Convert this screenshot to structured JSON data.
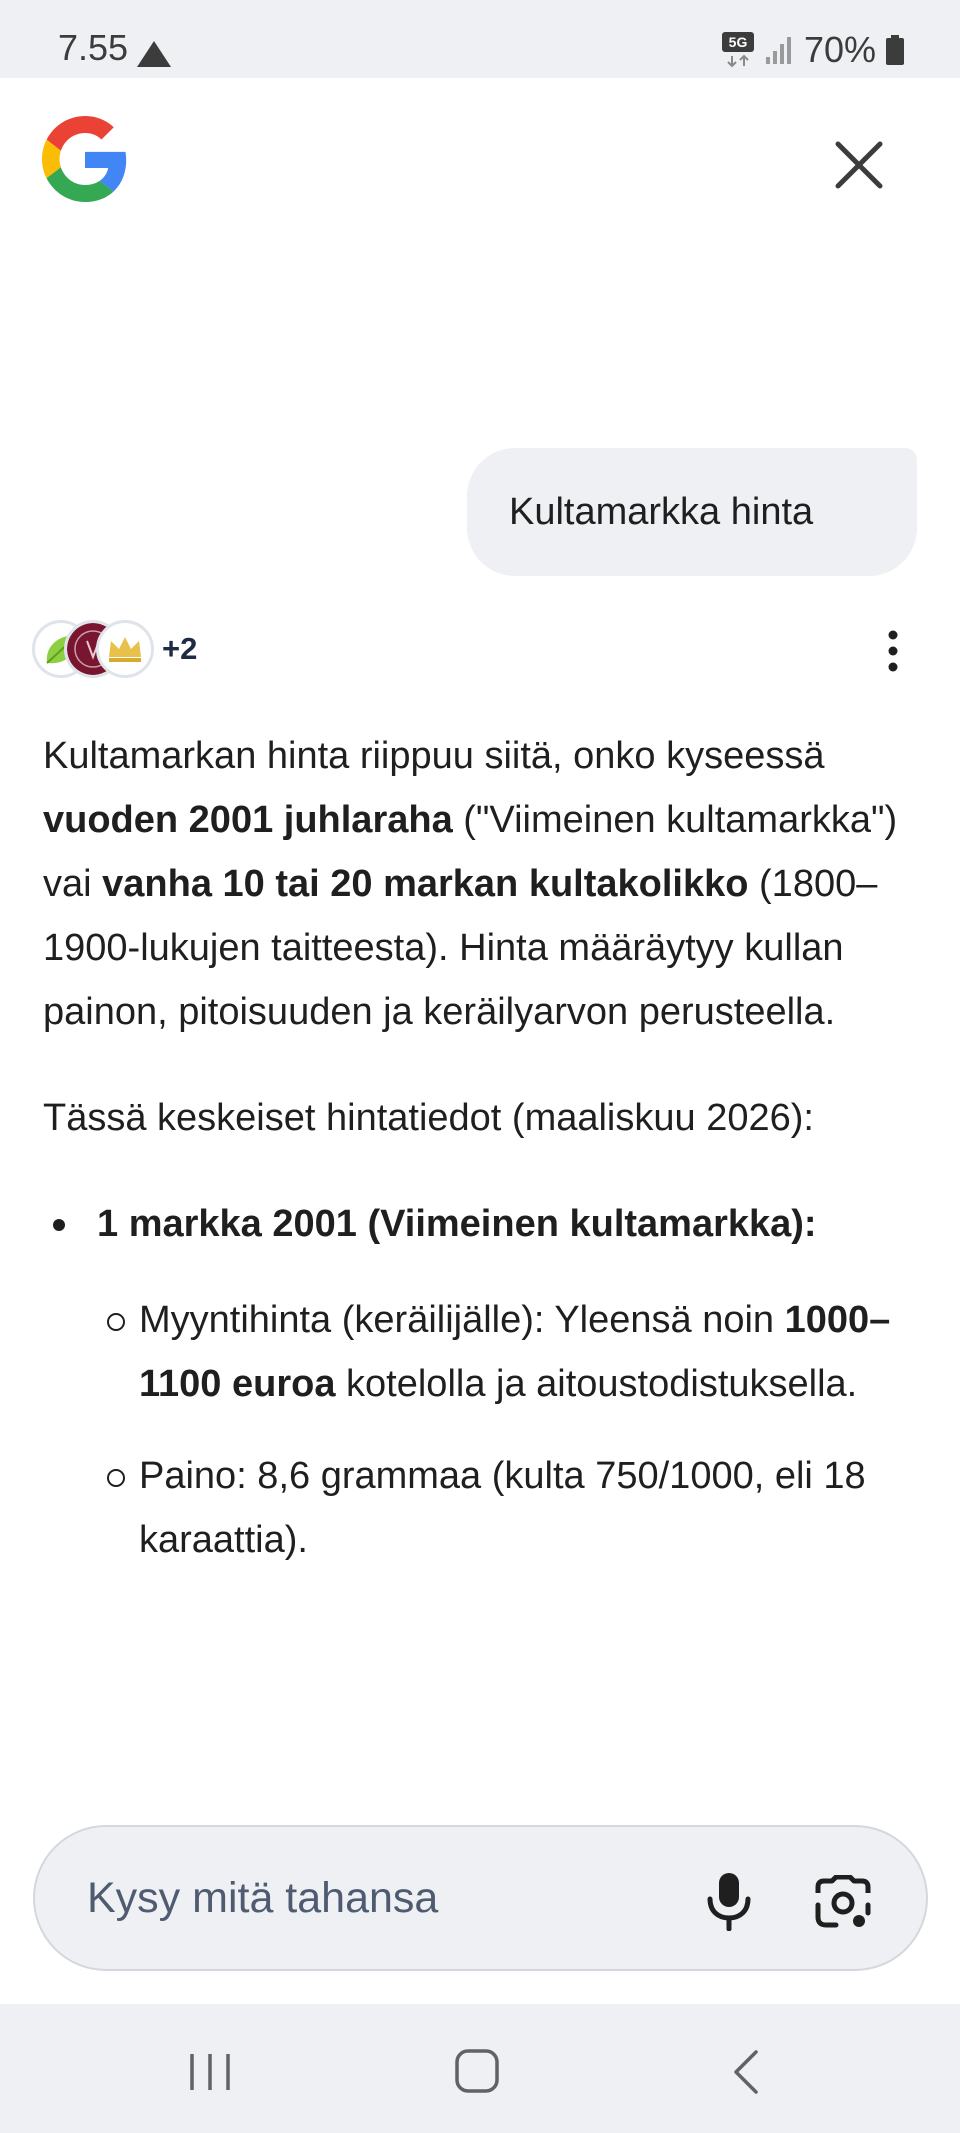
{
  "status_bar": {
    "time": "7.55",
    "network": "5G",
    "battery": "70%"
  },
  "header": {
    "logo": "google-logo",
    "close_icon": "close-icon"
  },
  "query": {
    "text": "Kultamarkka hinta"
  },
  "sources": {
    "more_count": "+2",
    "icons": [
      "birch-leaf-logo",
      "coin-seal-logo",
      "crown-logo"
    ]
  },
  "answer": {
    "p1": {
      "t1": "Kultamarkan hinta riippuu siitä, onko kyseessä ",
      "b1": "vuoden 2001 juhlaraha",
      "t2": " (\"Viimeinen kultamarkka\") vai ",
      "b2": "vanha 10 tai 20 markan kultakolikko",
      "t3": " (1800–1900-lukujen taitteesta). Hinta määräytyy kullan painon, pitoisuuden ja keräilyarvon perusteella."
    },
    "p2": "Tässä keskeiset hintatiedot (maaliskuu 2026):",
    "bullet1": "1 markka 2001 (Viimeinen kultamarkka):",
    "sub1": {
      "t1": "Myyntihinta (keräilijälle): Yleensä noin ",
      "b1": "1000–1100 euroa",
      "t2": " kotelolla ja aitoustodistuksella."
    },
    "sub2": "Paino: 8,6 grammaa (kulta 750/1000, eli 18 karaattia)."
  },
  "input": {
    "placeholder": "Kysy mitä tahansa"
  },
  "colors": {
    "surface": "#eef0f3",
    "text": "#1f1f1f",
    "placeholder": "#4f5b70"
  }
}
